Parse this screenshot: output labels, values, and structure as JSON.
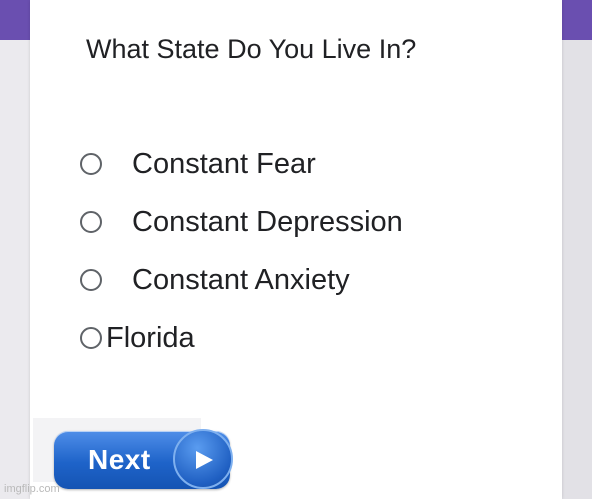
{
  "form": {
    "question": "What State Do You Live In?",
    "options": [
      {
        "label": "Constant Fear",
        "selected": false
      },
      {
        "label": "Constant Depression",
        "selected": false
      },
      {
        "label": "Constant Anxiety",
        "selected": false
      },
      {
        "label": "Florida",
        "selected": false
      }
    ],
    "next_label": "Next",
    "next_icon": "play-arrow-icon",
    "radio_icon": "radio-unchecked-icon"
  },
  "watermark": "imgflip.com",
  "colors": {
    "accent": "#6a4fb0",
    "button_blue": "#1e63c9",
    "radio_border": "#5f6368",
    "text": "#202124"
  }
}
